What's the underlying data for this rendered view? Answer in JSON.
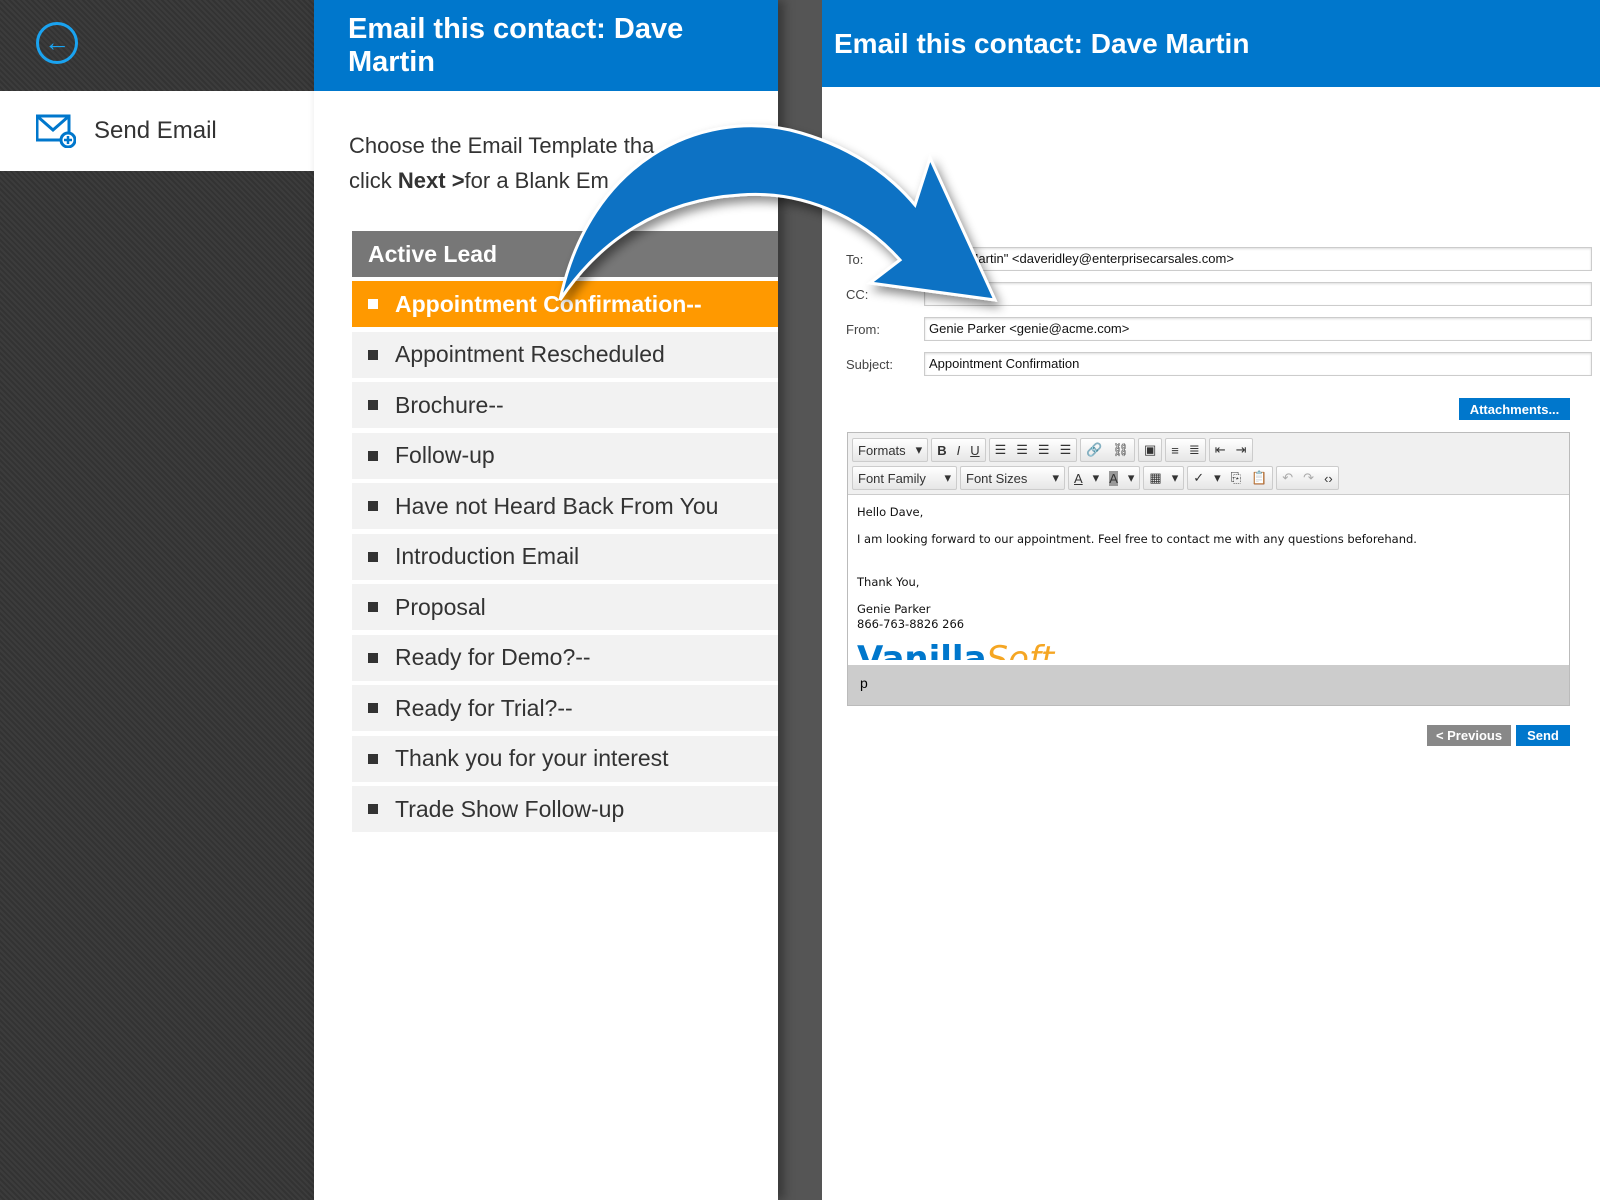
{
  "left": {
    "send_email": "Send Email"
  },
  "middle": {
    "title": "Email this contact: Dave Martin",
    "intro_1": "Choose the Email Template tha",
    "intro_2a": "click ",
    "intro_next": "Next >",
    "intro_2b": "for a Blank Em",
    "group": "Active Lead",
    "templates": [
      "Appointment Confirmation--",
      "Appointment Rescheduled",
      "Brochure--",
      "Follow-up",
      "Have not Heard Back From You",
      "Introduction Email",
      "Proposal",
      "Ready for Demo?--",
      "Ready for Trial?--",
      "Thank you for your interest",
      "Trade Show Follow-up"
    ],
    "selected": 0
  },
  "right": {
    "title": "Email this contact: Dave Martin",
    "to_label": "To:",
    "to": "\"Dave Martin\" <daveridley@enterprisecarsales.com>",
    "cc_label": "CC:",
    "cc": "",
    "from_label": "From:",
    "from": "Genie Parker <genie@acme.com>",
    "subject_label": "Subject:",
    "subject": "Appointment Confirmation",
    "attachments": "Attachments...",
    "toolbar": {
      "formats": "Formats",
      "font_family": "Font Family",
      "font_sizes": "Font Sizes"
    },
    "body": {
      "greeting": "Hello Dave,",
      "line1": "I am looking forward to our appointment.  Feel free to contact me with any questions beforehand.",
      "closing": "Thank You,",
      "name": "Genie Parker",
      "phone": "866-763-8826 266",
      "logo_a": "Vanilla",
      "logo_b": "Soft"
    },
    "status_path": "p",
    "previous": "< Previous",
    "send": "Send"
  },
  "colors": {
    "blue": "#0077cc",
    "orange": "#ff9900",
    "header_gray": "#777777"
  }
}
